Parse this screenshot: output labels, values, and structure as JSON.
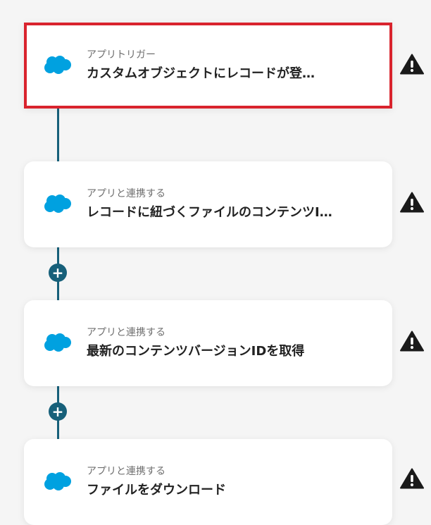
{
  "flow": {
    "steps": [
      {
        "subtitle": "アプリトリガー",
        "title": "カスタムオブジェクトにレコードが登…",
        "app_icon": "salesforce-cloud-icon",
        "status_icon": "warning-icon",
        "selected": true
      },
      {
        "subtitle": "アプリと連携する",
        "title": "レコードに紐づくファイルのコンテンツI…",
        "app_icon": "salesforce-cloud-icon",
        "status_icon": "warning-icon"
      },
      {
        "subtitle": "アプリと連携する",
        "title": "最新のコンテンツバージョンIDを取得",
        "app_icon": "salesforce-cloud-icon",
        "status_icon": "warning-icon"
      },
      {
        "subtitle": "アプリと連携する",
        "title": "ファイルをダウンロード",
        "app_icon": "salesforce-cloud-icon",
        "status_icon": "warning-icon"
      }
    ],
    "add_step_label": "+"
  },
  "colors": {
    "connector": "#17607a",
    "selected_border": "#d9232d",
    "salesforce_blue": "#00a1e0",
    "background": "#f5f5f5"
  }
}
